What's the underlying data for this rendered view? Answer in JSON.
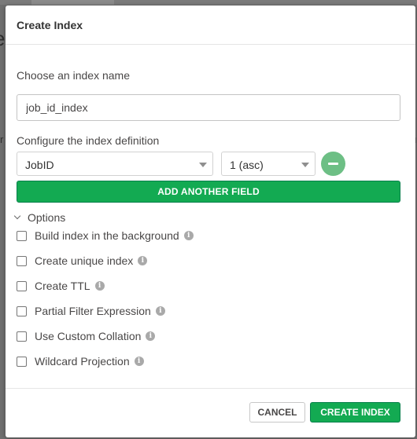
{
  "modal": {
    "title": "Create Index",
    "name_label": "Choose an index name",
    "name_value": "job_id_index",
    "definition_label": "Configure the index definition",
    "field": {
      "name": "JobID",
      "type": "1 (asc)"
    },
    "add_field_label": "ADD ANOTHER FIELD",
    "options_label": "Options",
    "options": [
      {
        "label": "Build index in the background",
        "checked": false
      },
      {
        "label": "Create unique index",
        "checked": false
      },
      {
        "label": "Create TTL",
        "checked": false
      },
      {
        "label": "Partial Filter Expression",
        "checked": false
      },
      {
        "label": "Use Custom Collation",
        "checked": false
      },
      {
        "label": "Wildcard Projection",
        "checked": false
      }
    ],
    "cancel_label": "CANCEL",
    "create_label": "CREATE INDEX"
  },
  "icons": {
    "info": "info-icon",
    "remove": "minus-circle-icon",
    "options_toggle": "chevron-down-icon",
    "select_caret": "caret-down-icon"
  },
  "colors": {
    "primary": "#13aa52",
    "remove_button": "#6dbf85",
    "backdrop": "#6f6f6f"
  }
}
